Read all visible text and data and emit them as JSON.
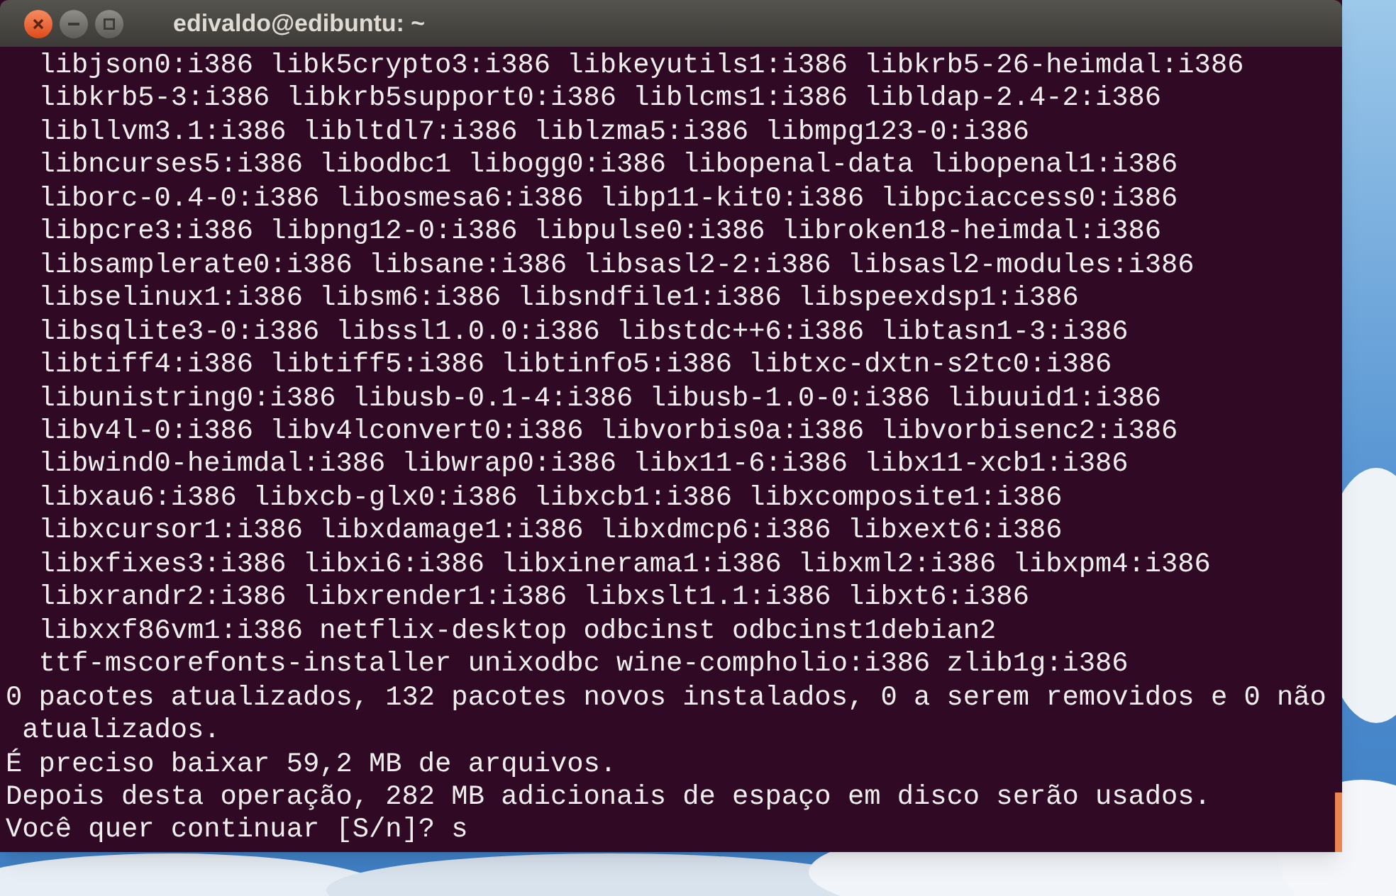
{
  "window": {
    "title": "edivaldo@edibuntu: ~"
  },
  "terminal": {
    "lines": [
      "  libjson0:i386 libk5crypto3:i386 libkeyutils1:i386 libkrb5-26-heimdal:i386",
      "  libkrb5-3:i386 libkrb5support0:i386 liblcms1:i386 libldap-2.4-2:i386",
      "  libllvm3.1:i386 libltdl7:i386 liblzma5:i386 libmpg123-0:i386",
      "  libncurses5:i386 libodbc1 libogg0:i386 libopenal-data libopenal1:i386",
      "  liborc-0.4-0:i386 libosmesa6:i386 libp11-kit0:i386 libpciaccess0:i386",
      "  libpcre3:i386 libpng12-0:i386 libpulse0:i386 libroken18-heimdal:i386",
      "  libsamplerate0:i386 libsane:i386 libsasl2-2:i386 libsasl2-modules:i386",
      "  libselinux1:i386 libsm6:i386 libsndfile1:i386 libspeexdsp1:i386",
      "  libsqlite3-0:i386 libssl1.0.0:i386 libstdc++6:i386 libtasn1-3:i386",
      "  libtiff4:i386 libtiff5:i386 libtinfo5:i386 libtxc-dxtn-s2tc0:i386",
      "  libunistring0:i386 libusb-0.1-4:i386 libusb-1.0-0:i386 libuuid1:i386",
      "  libv4l-0:i386 libv4lconvert0:i386 libvorbis0a:i386 libvorbisenc2:i386",
      "  libwind0-heimdal:i386 libwrap0:i386 libx11-6:i386 libx11-xcb1:i386",
      "  libxau6:i386 libxcb-glx0:i386 libxcb1:i386 libxcomposite1:i386",
      "  libxcursor1:i386 libxdamage1:i386 libxdmcp6:i386 libxext6:i386",
      "  libxfixes3:i386 libxi6:i386 libxinerama1:i386 libxml2:i386 libxpm4:i386",
      "  libxrandr2:i386 libxrender1:i386 libxslt1.1:i386 libxt6:i386",
      "  libxxf86vm1:i386 netflix-desktop odbcinst odbcinst1debian2",
      "  ttf-mscorefonts-installer unixodbc wine-compholio:i386 zlib1g:i386",
      "0 pacotes atualizados, 132 pacotes novos instalados, 0 a serem removidos e 0 não",
      " atualizados.",
      "É preciso baixar 59,2 MB de arquivos.",
      "Depois desta operação, 282 MB adicionais de espaço em disco serão usados.",
      "Você quer continuar [S/n]? s"
    ]
  }
}
